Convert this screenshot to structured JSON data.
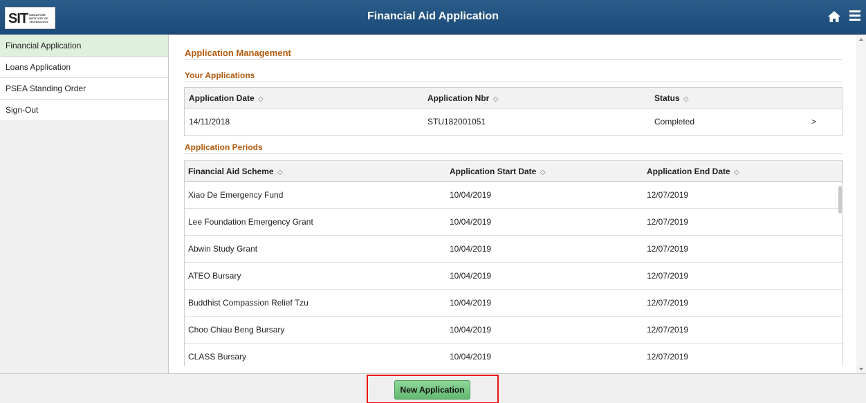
{
  "header": {
    "title": "Financial Aid Application",
    "logo_mark": "SIT",
    "logo_text": "SINGAPORE INSTITUTE OF TECHNOLOGY"
  },
  "sidebar": {
    "items": [
      {
        "label": "Financial Application",
        "active": true
      },
      {
        "label": "Loans Application",
        "active": false
      },
      {
        "label": "PSEA Standing Order",
        "active": false
      },
      {
        "label": "Sign-Out",
        "active": false
      }
    ]
  },
  "main": {
    "heading": "Application Management",
    "your_applications": {
      "title": "Your Applications",
      "columns": [
        "Application Date",
        "Application Nbr",
        "Status"
      ],
      "rows": [
        {
          "date": "14/11/2018",
          "nbr": "STU182001051",
          "status": "Completed",
          "chevron": ">"
        }
      ]
    },
    "periods": {
      "title": "Application Periods",
      "columns": [
        "Financial Aid Scheme",
        "Application Start Date",
        "Application End Date"
      ],
      "rows": [
        {
          "scheme": "Xiao De Emergency Fund",
          "start": "10/04/2019",
          "end": "12/07/2019"
        },
        {
          "scheme": "Lee Foundation Emergency Grant",
          "start": "10/04/2019",
          "end": "12/07/2019"
        },
        {
          "scheme": "Abwin Study Grant",
          "start": "10/04/2019",
          "end": "12/07/2019"
        },
        {
          "scheme": "ATEO Bursary",
          "start": "10/04/2019",
          "end": "12/07/2019"
        },
        {
          "scheme": "Buddhist Compassion Relief Tzu",
          "start": "10/04/2019",
          "end": "12/07/2019"
        },
        {
          "scheme": "Choo Chiau Beng Bursary",
          "start": "10/04/2019",
          "end": "12/07/2019"
        },
        {
          "scheme": "CLASS Bursary",
          "start": "10/04/2019",
          "end": "12/07/2019"
        }
      ]
    }
  },
  "footer": {
    "new_application_label": "New Application"
  },
  "colors": {
    "header": "#1b4a78",
    "section_title": "#b35a0e",
    "button": "#62b870",
    "highlight": "#e11111",
    "active_nav": "#dff0dc"
  },
  "sort_glyph": "◇",
  "icons": {
    "home": "home-icon",
    "menu": "hamburger-menu-icon"
  }
}
